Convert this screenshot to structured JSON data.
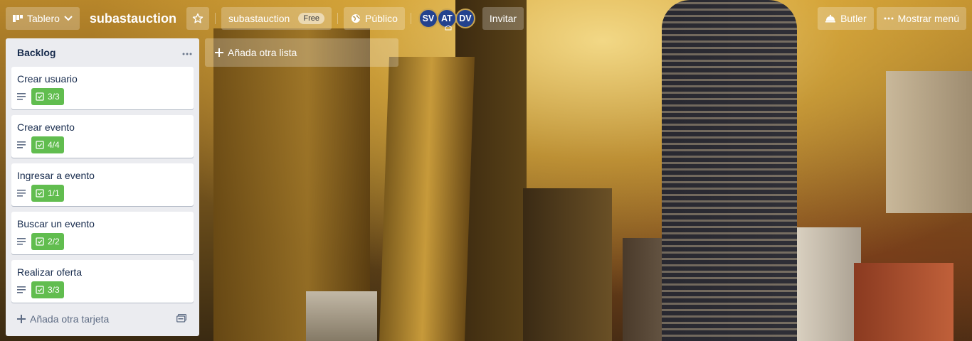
{
  "header": {
    "board_switch_label": "Tablero",
    "board_name": "subastauction",
    "workspace_name": "subastauction",
    "workspace_badge": "Free",
    "visibility_label": "Público",
    "members": [
      "SV",
      "AT",
      "DV"
    ],
    "invite_label": "Invitar",
    "butler_label": "Butler",
    "menu_label": "Mostrar menú"
  },
  "list": {
    "title": "Backlog",
    "menu_icon": "ellipsis-icon",
    "cards": [
      {
        "title": "Crear usuario",
        "checklist": "3/3"
      },
      {
        "title": "Crear evento",
        "checklist": "4/4"
      },
      {
        "title": "Ingresar a evento",
        "checklist": "1/1"
      },
      {
        "title": "Buscar un evento",
        "checklist": "2/2"
      },
      {
        "title": "Realizar oferta",
        "checklist": "3/3"
      }
    ],
    "add_card_label": "Añada otra tarjeta"
  },
  "add_list_label": "Añada otra lista",
  "colors": {
    "checklist_complete": "#61bd4f",
    "avatar": "#23428e",
    "list_bg": "#ebecf0"
  }
}
